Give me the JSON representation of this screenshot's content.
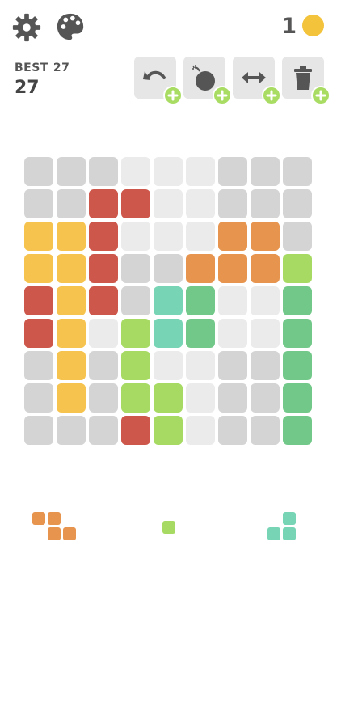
{
  "header": {
    "coin_count": "1",
    "best_label": "BEST",
    "best_value": "27",
    "score": "27"
  },
  "icons": {
    "settings": "gear-icon",
    "theme": "palette-icon",
    "coin": "coin-icon",
    "undo": "undo-icon",
    "bomb": "bomb-icon",
    "swap": "swap-arrows-icon",
    "trash": "trash-icon",
    "plus": "plus-icon"
  },
  "tools": [
    "undo",
    "bomb",
    "swap",
    "trash"
  ],
  "colors": {
    "empty": "#d4d4d4",
    "empty_light": "#ebebeb",
    "red": "#cd574b",
    "yellow": "#f6c34e",
    "orange": "#e6944e",
    "lime": "#a7da62",
    "teal": "#77d5b6",
    "green": "#72c889",
    "plus": "#a8dc62",
    "coin": "#f3c33c",
    "tool_bg": "#e6e6e6",
    "icon": "#555555"
  },
  "board": {
    "rows": [
      [
        "e",
        "e",
        "e",
        "l",
        "l",
        "l",
        "e",
        "e",
        "e"
      ],
      [
        "e",
        "e",
        "R",
        "R",
        "l",
        "l",
        "e",
        "e",
        "e"
      ],
      [
        "Y",
        "Y",
        "R",
        "l",
        "l",
        "l",
        "O",
        "O",
        "e"
      ],
      [
        "Y",
        "Y",
        "R",
        "e",
        "e",
        "O",
        "O",
        "O",
        "L"
      ],
      [
        "R",
        "Y",
        "R",
        "e",
        "T",
        "G",
        "l",
        "l",
        "G"
      ],
      [
        "R",
        "Y",
        "l",
        "L",
        "T",
        "G",
        "l",
        "l",
        "G"
      ],
      [
        "e",
        "Y",
        "e",
        "L",
        "l",
        "l",
        "e",
        "e",
        "G"
      ],
      [
        "e",
        "Y",
        "e",
        "L",
        "L",
        "l",
        "e",
        "e",
        "G"
      ],
      [
        "e",
        "e",
        "e",
        "R",
        "L",
        "l",
        "e",
        "e",
        "G"
      ]
    ]
  },
  "pieces": [
    {
      "color": "orange",
      "cells": [
        [
          0,
          0
        ],
        [
          1,
          0
        ],
        [
          1,
          1
        ],
        [
          2,
          1
        ]
      ]
    },
    {
      "color": "lime",
      "cells": [
        [
          0,
          0
        ]
      ]
    },
    {
      "color": "teal",
      "cells": [
        [
          1,
          0
        ],
        [
          0,
          1
        ],
        [
          1,
          1
        ]
      ]
    }
  ]
}
